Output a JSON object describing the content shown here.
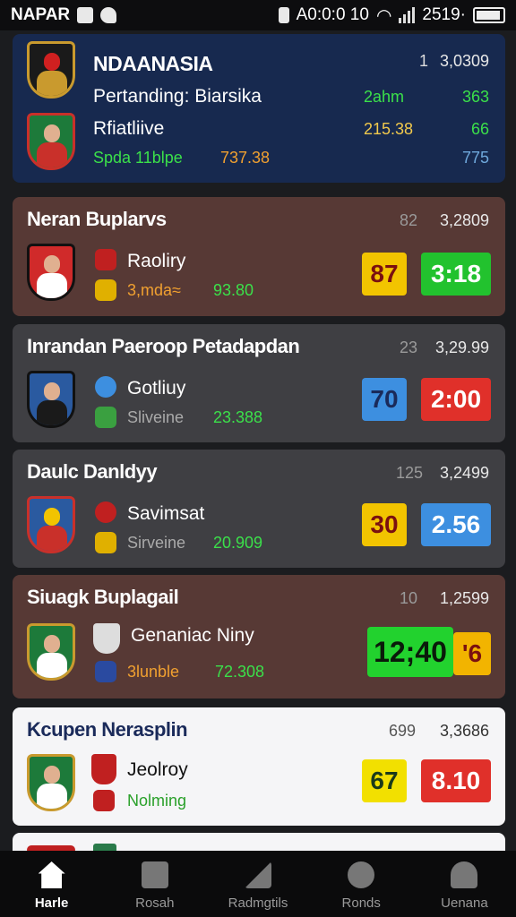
{
  "status": {
    "carrier": "NAPAR",
    "clock": "A0:0:0 10",
    "right": "2519·"
  },
  "cards": [
    {
      "style": "blue",
      "title": "NDAANASIA",
      "meta1": "1",
      "meta2": "3,0309",
      "team1": "Pertanding: Biarsika",
      "team1_val_a": "2ahm",
      "team1_val_b": "363",
      "team2": "Rfiatliive",
      "team2_val_a": "215.38",
      "team2_val_b": "66",
      "sub": "Spda 11blpe",
      "sub_val": "737.38",
      "sub_val2": "775"
    },
    {
      "style": "brown",
      "title": "Neran Buplarvs",
      "meta1": "82",
      "meta2": "3,2809",
      "team": "Raoliry",
      "sub": "3,mda≈",
      "sub_val": "93.80",
      "box1": "87",
      "box1_color": "#f2c400",
      "box2": "3:18",
      "box2_color": "#22c22e"
    },
    {
      "style": "grey",
      "title": "Inrandan Paeroop Petadapdan",
      "meta1": "23",
      "meta2": "3,29.99",
      "team": "Gotliuy",
      "sub": "Sliveine",
      "sub_val": "23.388",
      "box1": "70",
      "box1_color": "#3d8fe0",
      "box2": "2:00",
      "box2_color": "#e0302a"
    },
    {
      "style": "grey",
      "title": "Daulc Danldyy",
      "meta1": "125",
      "meta2": "3,2499",
      "team": "Savimsat",
      "sub": "Sirveine",
      "sub_val": "20.909",
      "box1": "30",
      "box1_color": "#f2c400",
      "box2": "2.56",
      "box2_color": "#3d8fe0"
    },
    {
      "style": "brown",
      "title": "Siuagk Buplagail",
      "meta1": "10",
      "meta2": "1,2599",
      "team": "Genaniac Niny",
      "sub": "3lunble",
      "sub_val": "72.308",
      "box1": "12;40",
      "box1_color": "#22d22e",
      "box2": "'6",
      "box2_color": "#f2b400"
    },
    {
      "style": "white",
      "title": "Kcupen Nerasplin",
      "meta1": "699",
      "meta2": "3,3686",
      "team": "Jeolroy",
      "sub": "Nolming",
      "box1": "67",
      "box1_color": "#f2e000",
      "box2": "8.10",
      "box2_color": "#e0302a"
    }
  ],
  "nav": [
    "Harle",
    "Rosah",
    "Radmgtils",
    "Ronds",
    "Uenana"
  ],
  "colors": {
    "green": "#3be04a",
    "yellow": "#f2c94c",
    "orange": "#f0a030",
    "blue_text": "#6fa8dc"
  }
}
